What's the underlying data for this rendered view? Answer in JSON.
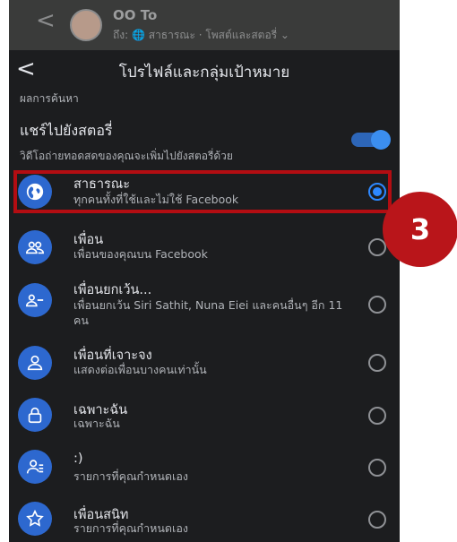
{
  "topbar": {
    "back_glyph": "<",
    "user_name": "OO To",
    "post_target": "ถึง: 🌐 สาธารณะ · โพสต์และสตอรี่ ⌄"
  },
  "header": {
    "back_glyph": "<",
    "title": "โปรไฟล์และกลุ่มเป้าหมาย"
  },
  "section_label": "ผลการค้นหา",
  "share_to_story": {
    "title": "แชร์ไปยังสตอรี่",
    "description": "วิดีโอถ่ายทอดสดของคุณจะเพิ่มไปยังสตอรี่ด้วย",
    "enabled": true
  },
  "audience_options": [
    {
      "title": "สาธารณะ",
      "description": "ทุกคนทั้งที่ใช้และไม่ใช้ Facebook",
      "icon": "globe-icon",
      "selected": true
    },
    {
      "title": "เพื่อน",
      "description": "เพื่อนของคุณบน Facebook",
      "icon": "friends-icon",
      "selected": false
    },
    {
      "title": "เพื่อนยกเว้น...",
      "description": "เพื่อนยกเว้น Siri Sathit, Nuna Eiei และคนอื่นๆ อีก 11 คน",
      "icon": "friends-except-icon",
      "selected": false
    },
    {
      "title": "เพื่อนที่เจาะจง",
      "description": "แสดงต่อเพื่อนบางคนเท่านั้น",
      "icon": "specific-friends-icon",
      "selected": false
    },
    {
      "title": "เฉพาะฉัน",
      "description": "เฉพาะฉัน",
      "icon": "lock-icon",
      "selected": false
    },
    {
      "title": ":)",
      "description": "รายการที่คุณกำหนดเอง",
      "icon": "custom-list-icon",
      "selected": false
    },
    {
      "title": "เพื่อนสนิท",
      "description": "รายการที่คุณกำหนดเอง",
      "icon": "star-icon",
      "selected": false
    }
  ],
  "step_badge": "3",
  "colors": {
    "accent": "#2d88ff",
    "icon_bg": "#2d68cf",
    "highlight": "#b30d12",
    "background": "#1c1d1f"
  }
}
